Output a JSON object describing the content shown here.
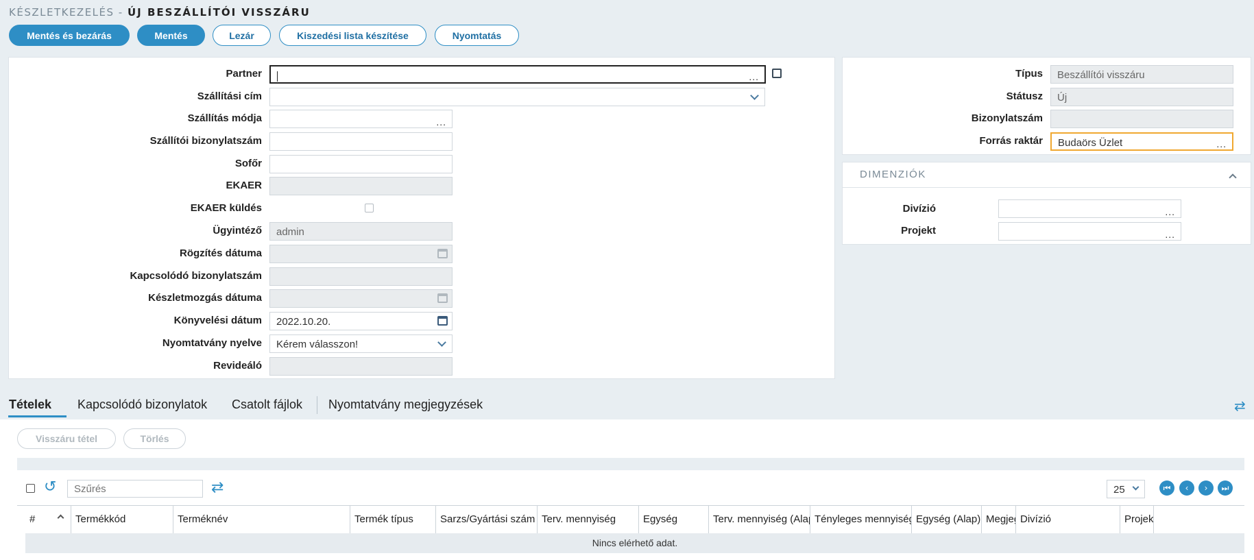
{
  "breadcrumb": {
    "section": "KÉSZLETKEZELÉS - ",
    "title": "ÚJ BESZÁLLÍTÓI VISSZÁRU"
  },
  "toolbar": {
    "save_close": "Mentés és bezárás",
    "save": "Mentés",
    "close": "Lezár",
    "picklist": "Kiszedési lista készítése",
    "print": "Nyomtatás"
  },
  "form": {
    "partner": {
      "label": "Partner",
      "value": ""
    },
    "shipping_address": {
      "label": "Szállítási cím",
      "value": ""
    },
    "shipping_method": {
      "label": "Szállítás módja",
      "value": ""
    },
    "supplier_doc_no": {
      "label": "Szállítói bizonylatszám",
      "value": ""
    },
    "driver": {
      "label": "Sofőr",
      "value": ""
    },
    "ekaer": {
      "label": "EKAER",
      "value": ""
    },
    "ekaer_send": {
      "label": "EKAER küldés",
      "checked": false
    },
    "agent": {
      "label": "Ügyintéző",
      "value": "admin"
    },
    "record_date": {
      "label": "Rögzítés dátuma",
      "value": ""
    },
    "related_doc_no": {
      "label": "Kapcsolódó bizonylatszám",
      "value": ""
    },
    "stock_move_date": {
      "label": "Készletmozgás dátuma",
      "value": ""
    },
    "posting_date": {
      "label": "Könyvelési dátum",
      "value": "2022.10.20."
    },
    "print_language": {
      "label": "Nyomtatvány nyelve",
      "value": "Kérem válasszon!"
    },
    "reviewer": {
      "label": "Revideáló",
      "value": ""
    }
  },
  "side": {
    "type": {
      "label": "Típus",
      "value": "Beszállítói visszáru"
    },
    "status": {
      "label": "Státusz",
      "value": "Új"
    },
    "doc_no": {
      "label": "Bizonylatszám",
      "value": ""
    },
    "source_warehouse": {
      "label": "Forrás raktár",
      "value": "Budaörs Üzlet"
    }
  },
  "dimensions": {
    "title": "DIMENZIÓK",
    "division": {
      "label": "Divízió",
      "value": ""
    },
    "project": {
      "label": "Projekt",
      "value": ""
    }
  },
  "tabs": [
    "Tételek",
    "Kapcsolódó bizonylatok",
    "Csatolt fájlok",
    "Nyomtatvány megjegyzések"
  ],
  "items": {
    "return_item_btn": "Visszáru tétel",
    "delete_btn": "Törlés",
    "filter_placeholder": "Szűrés",
    "page_size": "25",
    "columns": [
      "#",
      "Termékkód",
      "Terméknév",
      "Termék típus",
      "Sarzs/Gyártási szám",
      "Terv. mennyiség",
      "Egység",
      "Terv. mennyiség (Alap)",
      "Tényleges mennyiség",
      "Egység (Alap)",
      "Megjegyzés",
      "Divízió",
      "Projekt"
    ],
    "empty_text": "Nincs elérhető adat."
  },
  "colors": {
    "accent": "#2e8ec5",
    "focus_border": "#f0a830"
  }
}
